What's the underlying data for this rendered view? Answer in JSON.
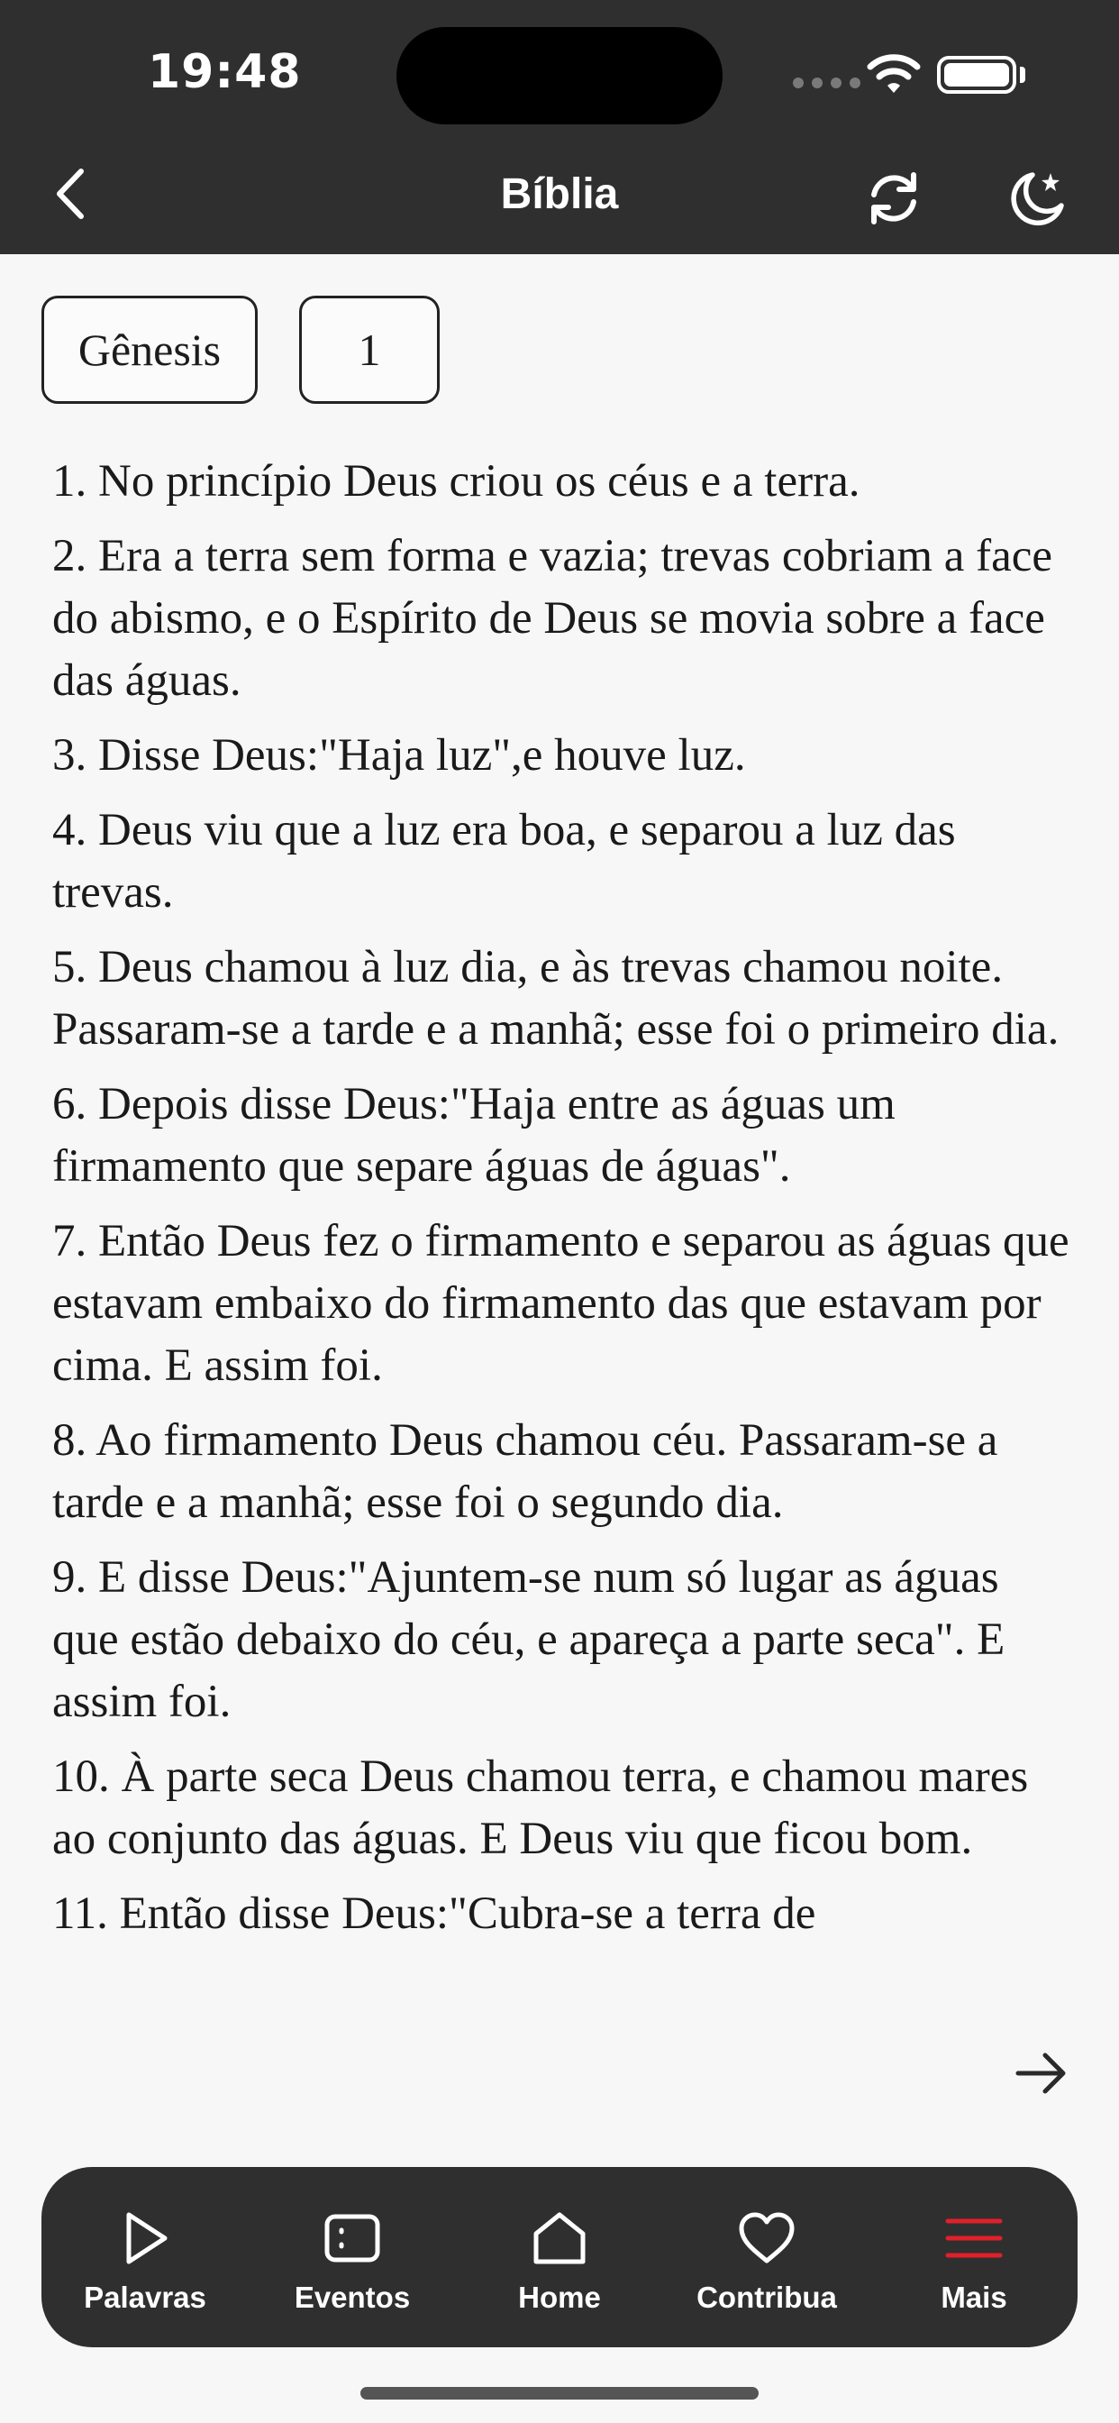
{
  "status_bar": {
    "time": "19:48"
  },
  "header": {
    "title": "Bíblia"
  },
  "selectors": {
    "book": "Gênesis",
    "chapter": "1"
  },
  "verses": [
    "1. No princípio Deus criou os céus e a terra.",
    "2. Era a terra sem forma e vazia; trevas cobriam a face do abismo, e o Espírito de Deus se movia sobre a face das águas.",
    "3. Disse Deus:\"Haja luz\",e houve luz.",
    "4. Deus viu que a luz era boa, e separou a luz das trevas.",
    "5. Deus chamou à luz dia, e às trevas chamou noite. Passaram-se a tarde e a manhã; esse foi o primeiro dia.",
    "6. Depois disse Deus:\"Haja entre as águas um firmamento que separe águas de águas\".",
    "7. Então Deus fez o firmamento e separou as águas que estavam embaixo do firmamento das que estavam por cima. E assim foi.",
    "8. Ao firmamento Deus chamou céu. Passaram-se a tarde e a manhã; esse foi o segundo dia.",
    "9. E disse Deus:\"Ajuntem-se num só lugar as águas que estão debaixo do céu, e apareça a parte seca\". E assim foi.",
    "10. À parte seca Deus chamou terra, e chamou mares ao conjunto das águas. E Deus viu que ficou bom.",
    "11. Então disse Deus:\"Cubra-se a terra de"
  ],
  "tabs": [
    {
      "label": "Palavras",
      "icon": "play-icon"
    },
    {
      "label": "Eventos",
      "icon": "list-icon"
    },
    {
      "label": "Home",
      "icon": "home-icon"
    },
    {
      "label": "Contribua",
      "icon": "heart-icon"
    },
    {
      "label": "Mais",
      "icon": "menu-icon"
    }
  ],
  "colors": {
    "header_bg": "#2f2f2f",
    "accent": "#e0202a",
    "text": "#1a1a1a",
    "background": "#f7f7f7"
  }
}
